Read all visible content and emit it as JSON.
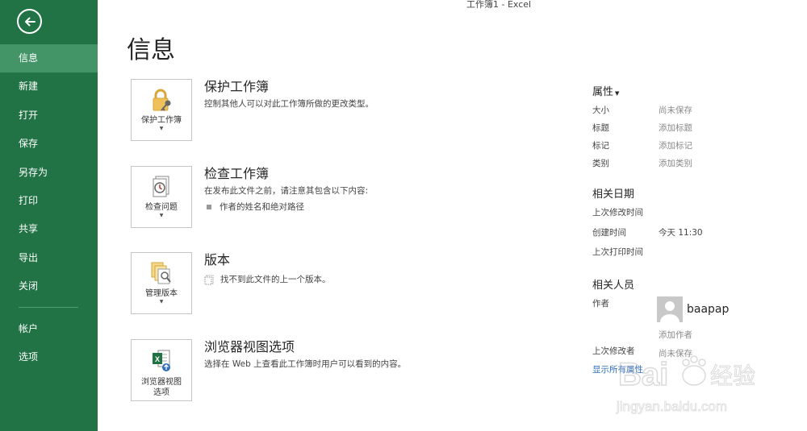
{
  "window": {
    "title": "工作簿1 - Excel"
  },
  "nav": {
    "items": [
      {
        "label": "信息",
        "active": true
      },
      {
        "label": "新建"
      },
      {
        "label": "打开"
      },
      {
        "label": "保存"
      },
      {
        "label": "另存为"
      },
      {
        "label": "打印"
      },
      {
        "label": "共享"
      },
      {
        "label": "导出"
      },
      {
        "label": "关闭"
      }
    ],
    "bottom": [
      {
        "label": "帐户"
      },
      {
        "label": "选项"
      }
    ]
  },
  "page": {
    "title": "信息"
  },
  "sections": {
    "protect": {
      "tile_label": "保护工作簿",
      "heading": "保护工作簿",
      "desc": "控制其他人可以对此工作簿所做的更改类型。"
    },
    "inspect": {
      "tile_label": "检查问题",
      "heading": "检查工作簿",
      "desc": "在发布此文件之前，请注意其包含以下内容:",
      "bullet": "作者的姓名和绝对路径"
    },
    "versions": {
      "tile_label": "管理版本",
      "heading": "版本",
      "desc": "找不到此文件的上一个版本。"
    },
    "browser": {
      "tile_label_1": "浏览器视图",
      "tile_label_2": "选项",
      "heading": "浏览器视图选项",
      "desc": "选择在 Web 上查看此工作簿时用户可以看到的内容。"
    }
  },
  "properties": {
    "heading": "属性",
    "rows": [
      {
        "label": "大小",
        "value": "尚未保存"
      },
      {
        "label": "标题",
        "value": "添加标题"
      },
      {
        "label": "标记",
        "value": "添加标记"
      },
      {
        "label": "类别",
        "value": "添加类别"
      }
    ],
    "dates_heading": "相关日期",
    "dates": [
      {
        "label": "上次修改时间",
        "value": ""
      },
      {
        "label": "创建时间",
        "value": "今天 11:30"
      },
      {
        "label": "上次打印时间",
        "value": ""
      }
    ],
    "people_heading": "相关人员",
    "author_label": "作者",
    "author_name": "baapap",
    "add_author": "添加作者",
    "last_modified_by_label": "上次修改者",
    "last_modified_by_value": "尚未保存",
    "show_all": "显示所有属性"
  },
  "watermark": {
    "text": "Bai 经验",
    "url": "jingyan.baidu.com"
  },
  "colors": {
    "sidebar": "#217346",
    "sidebar_active": "#439467",
    "link": "#2f6ebc"
  }
}
